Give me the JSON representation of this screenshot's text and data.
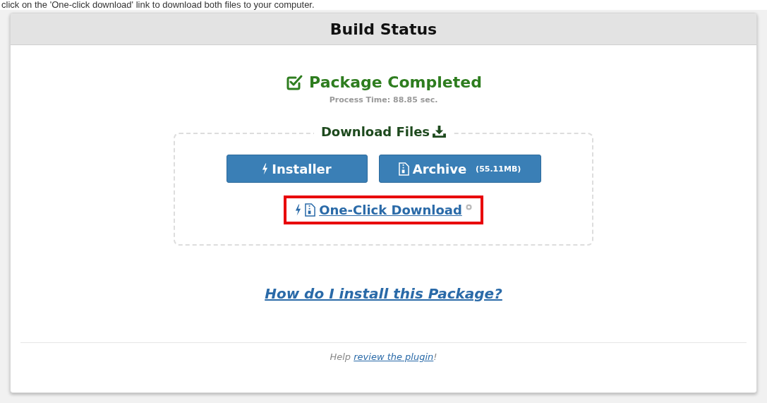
{
  "caption": "click on the 'One-click download' link to download both files to your computer.",
  "panel": {
    "title": "Build Status",
    "status": "Package Completed",
    "process_time": "Process Time: 88.85 sec.",
    "download": {
      "legend": "Download Files",
      "buttons": [
        {
          "kind": "installer",
          "label": "Installer"
        },
        {
          "kind": "archive",
          "label": "Archive",
          "size": "(55.11MB)"
        }
      ],
      "one_click": {
        "label": "One-Click Download",
        "highlighted": true
      }
    },
    "help_link": "How do I install this Package?",
    "footer": {
      "before": "Help",
      "link": "review the plugin",
      "after": "!"
    }
  }
}
